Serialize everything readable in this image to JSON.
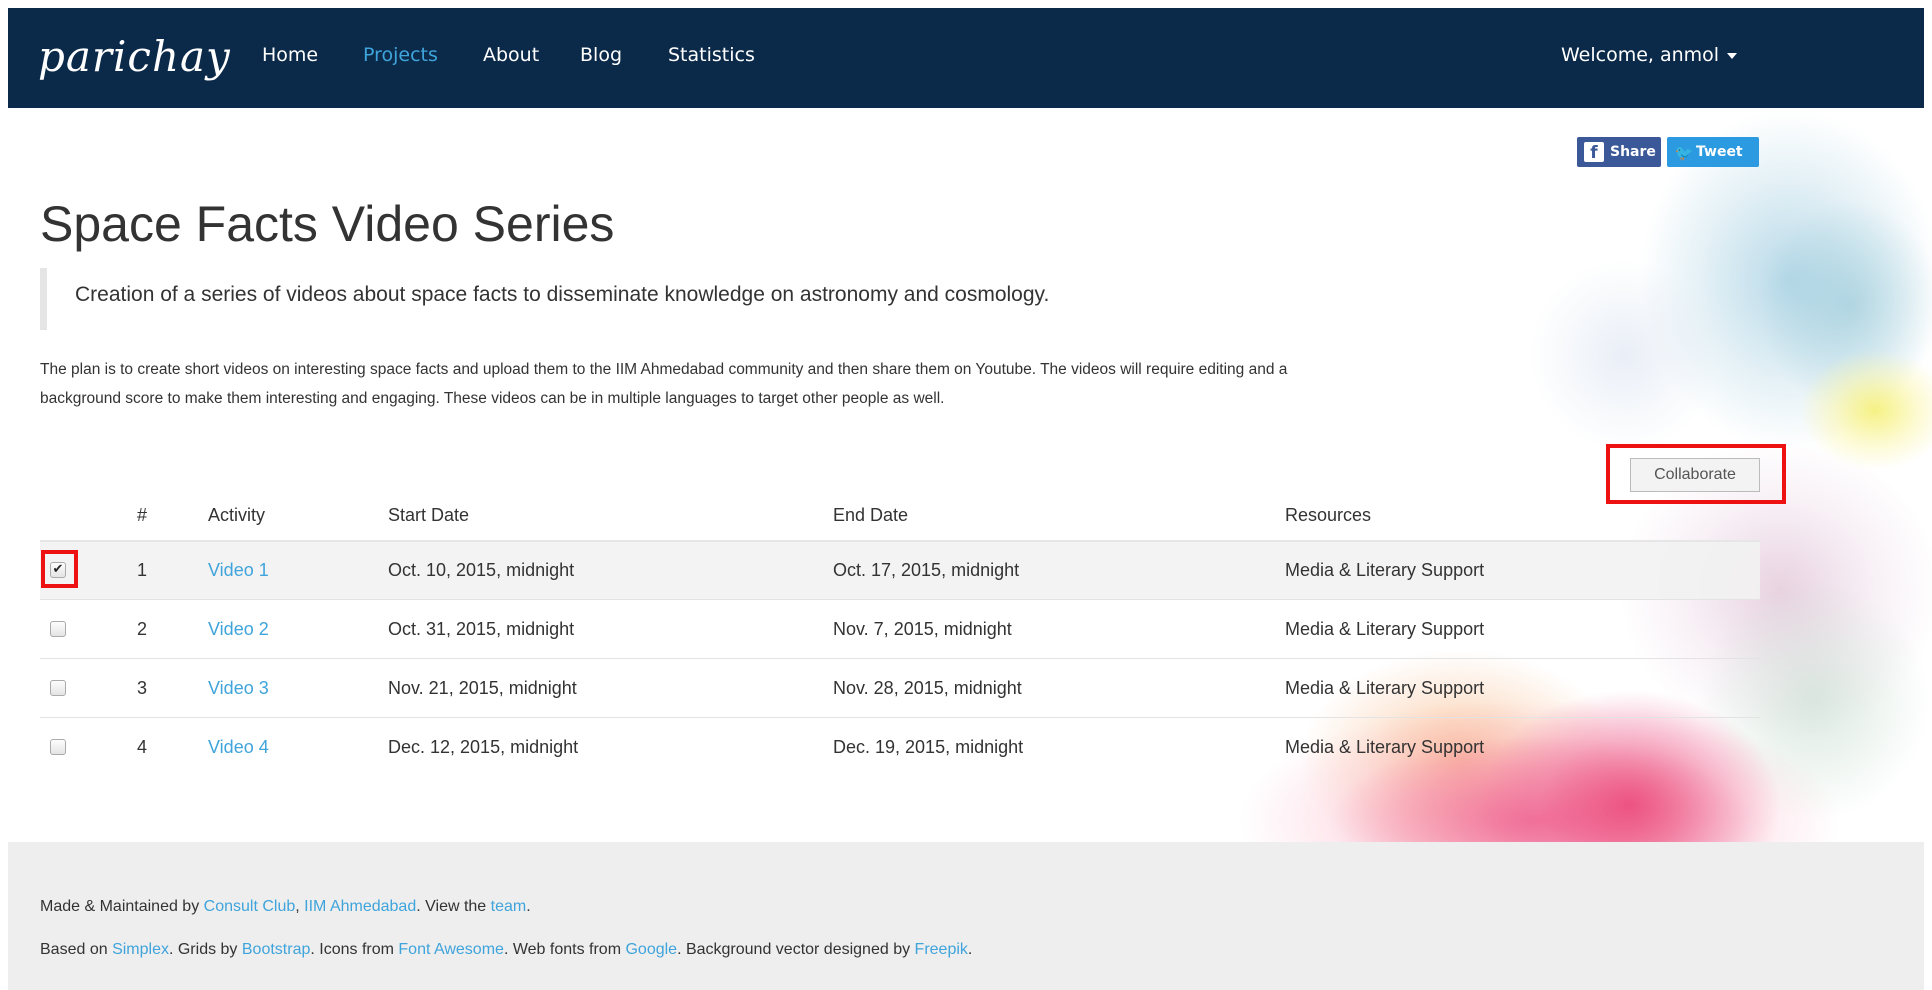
{
  "nav": {
    "brand": "parichay",
    "links": [
      "Home",
      "Projects",
      "About",
      "Blog",
      "Statistics"
    ],
    "active": "Projects",
    "welcome": "Welcome, anmol"
  },
  "social": {
    "share_label": "Share",
    "tweet_label": "Tweet",
    "share_icon_glyph": "f",
    "tweet_icon_glyph": "🐦"
  },
  "project": {
    "title": "Space Facts Video Series",
    "summary": "Creation of a series of videos about space facts to disseminate knowledge on astronomy and cosmology.",
    "description_line1": "The plan is to create short videos on interesting space facts and upload them to the IIM Ahmedabad community and then share them on Youtube. The videos will require editing and a",
    "description_line2": "background score to make them interesting and engaging. These videos can be in multiple languages to target other people as well."
  },
  "collaborate_label": "Collaborate",
  "table": {
    "headers": [
      "#",
      "Activity",
      "Start Date",
      "End Date",
      "Resources"
    ],
    "rows": [
      {
        "checked": true,
        "num": "1",
        "activity": "Video 1",
        "start": "Oct. 10, 2015, midnight",
        "end": "Oct. 17, 2015, midnight",
        "resources": "Media & Literary Support"
      },
      {
        "checked": false,
        "num": "2",
        "activity": "Video 2",
        "start": "Oct. 31, 2015, midnight",
        "end": "Nov. 7, 2015, midnight",
        "resources": "Media & Literary Support"
      },
      {
        "checked": false,
        "num": "3",
        "activity": "Video 3",
        "start": "Nov. 21, 2015, midnight",
        "end": "Nov. 28, 2015, midnight",
        "resources": "Media & Literary Support"
      },
      {
        "checked": false,
        "num": "4",
        "activity": "Video 4",
        "start": "Dec. 12, 2015, midnight",
        "end": "Dec. 19, 2015, midnight",
        "resources": "Media & Literary Support"
      }
    ]
  },
  "footer": {
    "line1": {
      "t1": "Made & Maintained by ",
      "l1": "Consult Club",
      "t2": ", ",
      "l2": "IIM Ahmedabad",
      "t3": ". View the ",
      "l3": "team",
      "t4": "."
    },
    "line2": {
      "t1": "Based on ",
      "l1": "Simplex",
      "t2": ". Grids by ",
      "l2": "Bootstrap",
      "t3": ". Icons from ",
      "l3": "Font Awesome",
      "t4": ". Web fonts from ",
      "l4": "Google",
      "t5": ". Background vector designed by ",
      "l5": "Freepik",
      "t6": "."
    }
  },
  "colors": {
    "navbar": "#0b2a4a",
    "accent": "#3fa4dc",
    "highlight": "#ee1111"
  }
}
